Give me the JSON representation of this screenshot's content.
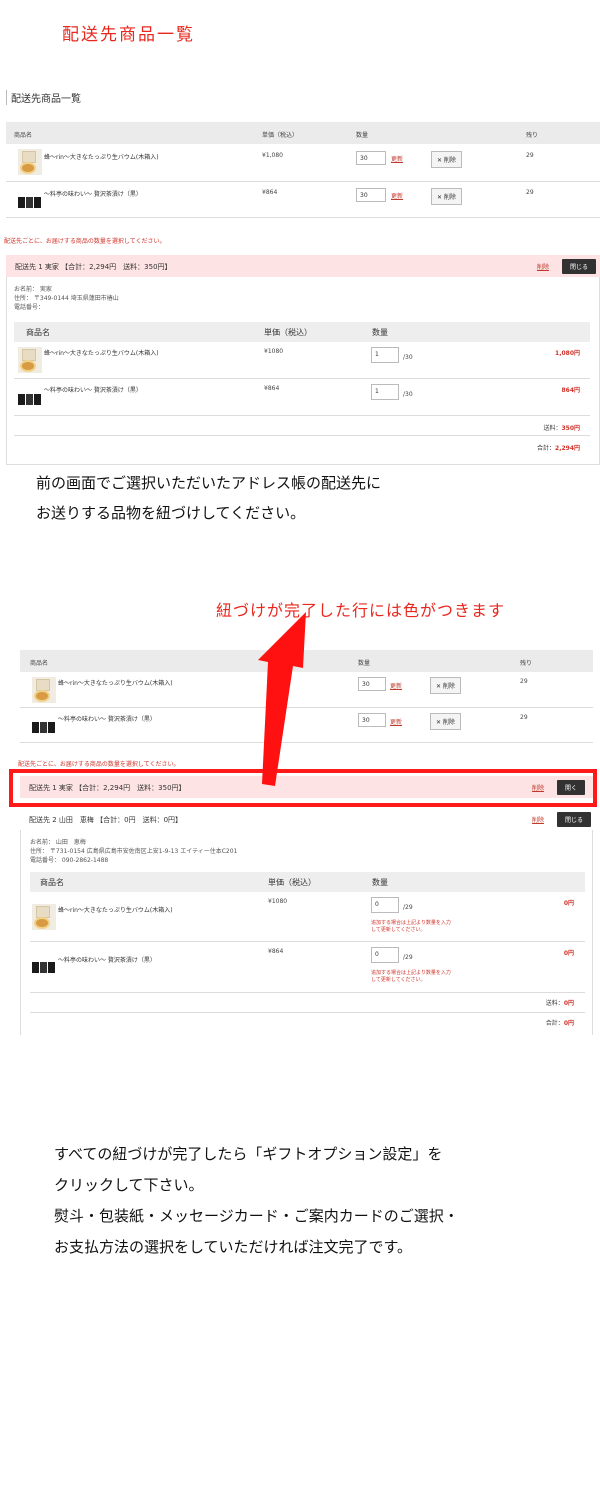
{
  "page_title": "配送先商品一覧",
  "section1": {
    "title": "配送先商品一覧",
    "headers": [
      "商品名",
      "単価（税込）",
      "数量",
      "残り"
    ],
    "rows": [
      {
        "name": "蜂～rin～大きなたっぷり生バウム(木箱入)",
        "price": "¥1,080",
        "qty": "30",
        "update": "更新",
        "delete": "✕ 削除",
        "remain": "29"
      },
      {
        "name": "～料亭の味わい～ 贅沢茶漬け（黒）",
        "price": "¥864",
        "qty": "30",
        "update": "更新",
        "delete": "✕ 削除",
        "remain": "29"
      }
    ],
    "note": "配送先ごとに、お届けする商品の数量を選択してください。",
    "ship1": {
      "label": "配送先 1 実家 【合計：2,294円　送料：350円】",
      "remove": "削除",
      "close": "閉じる",
      "addr_name": "お名前： 実家",
      "addr_address": "住所： 〒349-0144 埼玉県蓮田市椿山",
      "addr_phone": "電話番号：",
      "headers": [
        "商品名",
        "単価（税込）",
        "数量"
      ],
      "rows": [
        {
          "name": "蜂～rin～大きなたっぷり生バウム(木箱入)",
          "price": "¥1080",
          "qty": "1",
          "max": "/30",
          "amount": "1,080円"
        },
        {
          "name": "～料亭の味わい～ 贅沢茶漬け（黒）",
          "price": "¥864",
          "qty": "1",
          "max": "/30",
          "amount": "864円"
        }
      ],
      "shipping_label": "送料：",
      "shipping_value": "350円",
      "total_label": "合計：",
      "total_value": "2,294円"
    }
  },
  "caption1": [
    "前の画面でご選択いただいたアドレス帳の配送先に",
    "お送りする品物を紐づけしてください。"
  ],
  "annotation": "紐づけが完了した行には色がつきます",
  "section2": {
    "headers": [
      "商品名",
      "数量",
      "残り"
    ],
    "rows": [
      {
        "name": "蜂～rin～大きなたっぷり生バウム(木箱入)",
        "price": "¥1,08",
        "qty": "30",
        "update": "更新",
        "delete": "✕ 削除",
        "remain": "29"
      },
      {
        "name": "～料亭の味わい～ 贅沢茶漬け（黒）",
        "price": "¥8",
        "qty": "30",
        "update": "更新",
        "delete": "✕ 削除",
        "remain": "29"
      }
    ],
    "note": "配送先ごとに、お届けする商品の数量を選択してください。",
    "ship1": {
      "label": "配送先 1 実家 【合計：2,294円　送料：350円】",
      "remove": "削除",
      "open": "開く"
    },
    "ship2": {
      "label": "配送先 2 山田　恵梅 【合計：0円　送料：0円】",
      "remove": "削除",
      "close": "閉じる",
      "addr_name": "お名前： 山田　恵梅",
      "addr_address": "住所： 〒731-0154 広島県広島市安佐南区上安1-9-13 エイティー住本C201",
      "addr_phone": "電話番号： 090-2862-1488",
      "headers": [
        "商品名",
        "単価（税込）",
        "数量"
      ],
      "rows": [
        {
          "name": "蜂～rin～大きなたっぷり生バウム(木箱入)",
          "price": "¥1080",
          "qty": "0",
          "max": "/29",
          "amount": "0円",
          "hint1": "追加する場合は上記より数量を入力",
          "hint2": "して更新してください。"
        },
        {
          "name": "～料亭の味わい～ 贅沢茶漬け（黒）",
          "price": "¥864",
          "qty": "0",
          "max": "/29",
          "amount": "0円",
          "hint1": "追加する場合は上記より数量を入力",
          "hint2": "して更新してください。"
        }
      ],
      "shipping_label": "送料：",
      "shipping_value": "0円",
      "total_label": "合計：",
      "total_value": "0円"
    }
  },
  "caption2": [
    "すべての紐づけが完了したら「ギフトオプション設定」を",
    "クリックして下さい。",
    "熨斗・包装紙・メッセージカード・ご案内カードのご選択・",
    "お支払方法の選択をしていただければ注文完了です。"
  ],
  "colors": {
    "accent_red": "#e8281e",
    "highlight_pink": "#fde3e3",
    "dark_button": "#323232"
  }
}
